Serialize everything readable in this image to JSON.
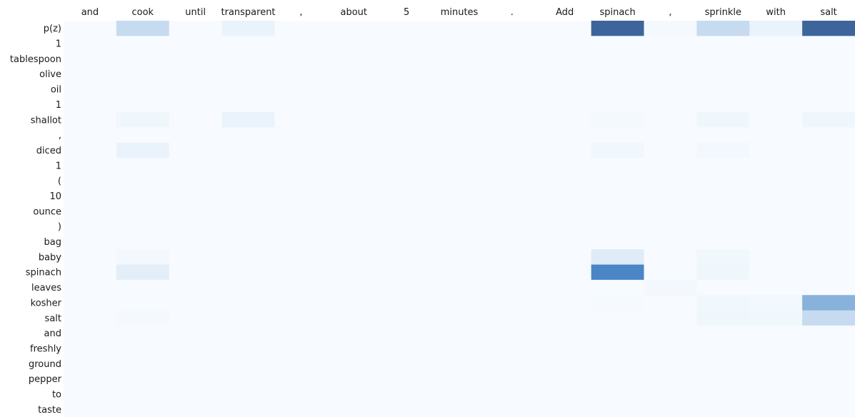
{
  "chart_data": {
    "type": "heatmap",
    "title": "",
    "x_labels": [
      "and",
      "cook",
      "until",
      "transparent",
      ",",
      "about",
      "5",
      "minutes",
      ".",
      "Add",
      "spinach",
      ",",
      "sprinkle",
      "with",
      "salt"
    ],
    "y_labels": [
      "p(z)",
      "1",
      "tablespoon",
      "olive",
      "oil",
      "1",
      "shallot",
      ",",
      "diced",
      "1",
      "(",
      "10",
      "ounce",
      ")",
      "bag",
      "baby",
      "spinach",
      "leaves",
      "kosher",
      "salt",
      "and",
      "freshly",
      "ground",
      "pepper",
      "to",
      "taste"
    ],
    "values": [
      [
        0,
        0.3,
        0,
        0.08,
        0,
        0,
        0,
        0,
        0,
        0,
        0.95,
        0.02,
        0.3,
        0.08,
        0.95
      ],
      [
        0,
        0,
        0,
        0,
        0,
        0,
        0,
        0,
        0,
        0,
        0,
        0,
        0,
        0,
        0
      ],
      [
        0,
        0,
        0,
        0,
        0,
        0,
        0,
        0,
        0,
        0,
        0,
        0,
        0,
        0,
        0
      ],
      [
        0,
        0,
        0,
        0,
        0,
        0,
        0,
        0,
        0,
        0,
        0,
        0,
        0,
        0,
        0
      ],
      [
        0,
        0,
        0,
        0,
        0,
        0,
        0,
        0,
        0,
        0,
        0,
        0,
        0,
        0,
        0
      ],
      [
        0,
        0,
        0,
        0,
        0,
        0,
        0,
        0,
        0,
        0,
        0,
        0,
        0,
        0,
        0
      ],
      [
        0,
        0.05,
        0,
        0.08,
        0,
        0,
        0,
        0,
        0,
        0,
        0.02,
        0,
        0.05,
        0,
        0.05
      ],
      [
        0,
        0,
        0,
        0,
        0,
        0,
        0,
        0,
        0,
        0,
        0,
        0,
        0,
        0,
        0
      ],
      [
        0,
        0.08,
        0,
        0,
        0,
        0,
        0,
        0,
        0,
        0,
        0.04,
        0,
        0.03,
        0,
        0
      ],
      [
        0,
        0,
        0,
        0,
        0,
        0,
        0,
        0,
        0,
        0,
        0,
        0,
        0,
        0,
        0
      ],
      [
        0,
        0,
        0,
        0,
        0,
        0,
        0,
        0,
        0,
        0,
        0,
        0,
        0,
        0,
        0
      ],
      [
        0,
        0,
        0,
        0,
        0,
        0,
        0,
        0,
        0,
        0,
        0,
        0,
        0,
        0,
        0
      ],
      [
        0,
        0,
        0,
        0,
        0,
        0,
        0,
        0,
        0,
        0,
        0,
        0,
        0,
        0,
        0
      ],
      [
        0,
        0,
        0,
        0,
        0,
        0,
        0,
        0,
        0,
        0,
        0,
        0,
        0,
        0,
        0
      ],
      [
        0,
        0,
        0,
        0,
        0,
        0,
        0,
        0,
        0,
        0,
        0,
        0,
        0,
        0,
        0
      ],
      [
        0,
        0.03,
        0,
        0,
        0,
        0,
        0,
        0,
        0,
        0,
        0.15,
        0,
        0.04,
        0,
        0
      ],
      [
        0,
        0.12,
        0,
        0,
        0,
        0,
        0,
        0,
        0,
        0,
        0.7,
        0,
        0.05,
        0,
        0
      ],
      [
        0,
        0,
        0,
        0,
        0,
        0,
        0,
        0,
        0,
        0,
        0,
        0.03,
        0,
        0,
        0
      ],
      [
        0,
        0,
        0,
        0,
        0,
        0,
        0,
        0,
        0,
        0,
        0.01,
        0,
        0.04,
        0.03,
        0.5
      ],
      [
        0,
        0.02,
        0,
        0,
        0,
        0,
        0,
        0,
        0,
        0,
        0,
        0,
        0.05,
        0.04,
        0.3
      ],
      [
        0,
        0,
        0,
        0,
        0,
        0,
        0,
        0,
        0,
        0,
        0,
        0,
        0,
        0,
        0
      ],
      [
        0,
        0,
        0,
        0,
        0,
        0,
        0,
        0,
        0,
        0,
        0,
        0,
        0,
        0,
        0
      ],
      [
        0,
        0,
        0,
        0,
        0,
        0,
        0,
        0,
        0,
        0,
        0,
        0,
        0,
        0,
        0
      ],
      [
        0,
        0,
        0,
        0,
        0,
        0,
        0,
        0,
        0,
        0,
        0,
        0,
        0,
        0,
        0
      ],
      [
        0,
        0,
        0,
        0,
        0,
        0,
        0,
        0,
        0,
        0,
        0,
        0,
        0,
        0,
        0
      ],
      [
        0,
        0,
        0,
        0,
        0,
        0,
        0,
        0,
        0,
        0,
        0,
        0,
        0,
        0,
        0
      ]
    ],
    "value_range": [
      0,
      1
    ],
    "colormap": "Blues",
    "color_low": "#f7fbff",
    "color_high": "#3a5e93",
    "x_axis_position": "top",
    "grid": false,
    "legend": "none"
  }
}
